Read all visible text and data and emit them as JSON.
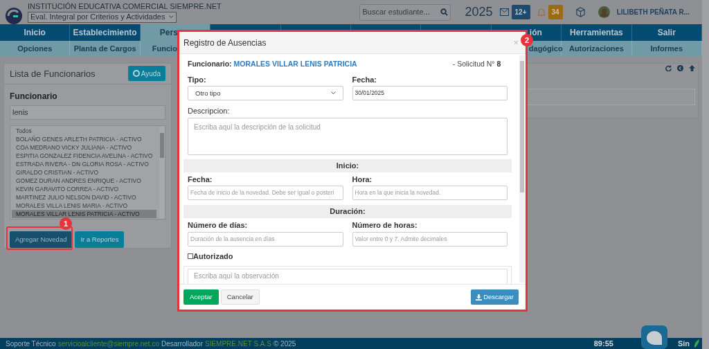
{
  "header": {
    "school": "INSTITUCIÓN EDUCATIVA COMERCIAL SIEMPRE.NET",
    "period_select": "Eval. Integral por Criterios y Actividades",
    "search": {
      "placeholder": "Buscar estudiante..."
    },
    "year": "2025",
    "messages_badge": "12+",
    "alerts_badge": "34",
    "user": "LILIBETH PEÑATA R..."
  },
  "main_menu": [
    {
      "label": "Inicio",
      "selected": false
    },
    {
      "label": "Establecimiento",
      "selected": false
    },
    {
      "label": "Pers",
      "selected": true
    },
    {
      "label": "ión",
      "selected": false
    },
    {
      "label": "Herramientas",
      "selected": false
    },
    {
      "label": "Salir",
      "selected": false
    }
  ],
  "sub_menu": [
    {
      "label": "Opciones"
    },
    {
      "label": "Planta de Cargos"
    },
    {
      "label": "Funcio"
    },
    {
      "label": "dagógico"
    },
    {
      "label": "Autorizaciones"
    },
    {
      "label": "Informes"
    }
  ],
  "staff_panel": {
    "title": "Lista de Funcionarios",
    "help_button": "Ayuda",
    "field_label": "Funcionario",
    "filter_value": "lenis",
    "list": [
      {
        "label": "Todos",
        "selected": false
      },
      {
        "label": "BOLAÑO GENES ARLETH PATRICIA - ACTIVO",
        "selected": false
      },
      {
        "label": "COA MEDRANO VICKY JULIANA - ACTIVO",
        "selected": false
      },
      {
        "label": "ESPITIA GONZALEZ FIDENCIA AVELINA - ACTIVO",
        "selected": false
      },
      {
        "label": "ESTRADA RIVERA - DN GLORIA ROSA - ACTIVO",
        "selected": false
      },
      {
        "label": "GIRALDO CRISTIAN - ACTIVO",
        "selected": false
      },
      {
        "label": "GOMEZ DURAN ANDRES ENRIQUE - ACTIVO",
        "selected": false
      },
      {
        "label": "KEVIN GARAVITO CORREA - ACTIVO",
        "selected": false
      },
      {
        "label": "MARTINEZ JULIO NELSON DAVID - ACTIVO",
        "selected": false
      },
      {
        "label": "MORALES VILLA LENIS MARIA - ACTIVO",
        "selected": false
      },
      {
        "label": "MORALES VILLAR LENIS PATRICIA - ACTIVO",
        "selected": true
      }
    ],
    "buttons": [
      "Agregar Novedad",
      "Ir a Reportes"
    ]
  },
  "modal": {
    "title": "Registro de Ausencias",
    "close": "×",
    "employee_label": "Funcionario:",
    "employee_name": "MORALES VILLAR LENIS PATRICIA",
    "request_label": "- Solicitud N°",
    "request_number": "8",
    "type_label": "Tipo:",
    "type_value": "Otro tipo",
    "date_label": "Fecha:",
    "date_value": "30/01/2025",
    "description_label": "Descripcion:",
    "description_placeholder": "Escriba aquí la descripción de la solicitud",
    "start_heading": "Inicio:",
    "start_date_label": "Fecha:",
    "start_date_placeholder": "Fecha de inicio de la novedad. Debe ser igual o posteri",
    "start_time_label": "Hora:",
    "start_time_placeholder": "Hora en la que inicia la novedad.",
    "duration_heading": "Duración:",
    "days_label": "Número de días:",
    "days_placeholder": "Duración de la ausencia en días",
    "hours_label": "Número de horas:",
    "hours_placeholder": "Valor entre 0 y 7. Admite decimales",
    "authorized_label": "Autorizado",
    "authorized": false,
    "observation_placeholder": "Escriba aquí la observación",
    "buttons": {
      "accept": "Aceptar",
      "cancel": "Cancelar",
      "download": "Descargar"
    }
  },
  "annotations": [
    {
      "label": "1"
    },
    {
      "label": "2"
    }
  ],
  "footer": {
    "support_label": "Soporte Técnico",
    "support_email": "servicioalcliente@siempre.net.co",
    "developer_label": "Desarrollador",
    "developer": "SIEMPRE.NET S.A.S",
    "copyright": "© 2025",
    "timer": "89:55",
    "right_text": "Sin"
  }
}
